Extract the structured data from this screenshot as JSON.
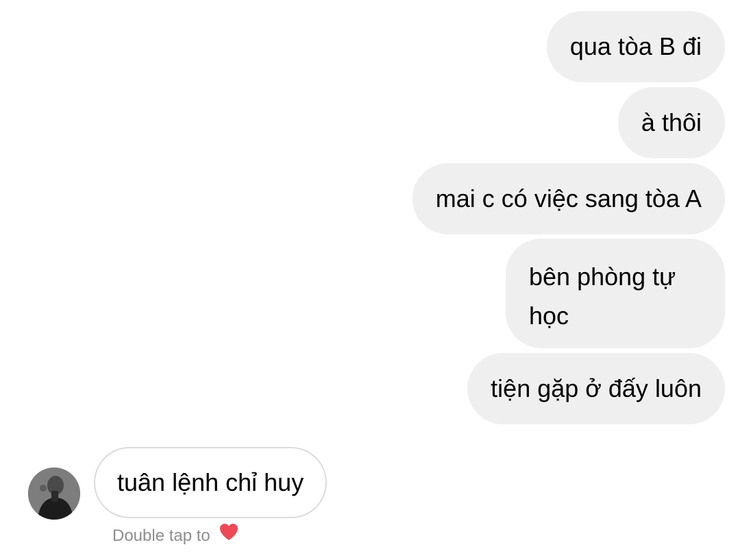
{
  "outgoing_messages": [
    {
      "text": "qua tòa B đi"
    },
    {
      "text": "à thôi"
    },
    {
      "text": "mai c có việc sang tòa A"
    },
    {
      "text": "bên phòng tự học"
    },
    {
      "text": "tiện gặp ở đấy luôn"
    }
  ],
  "incoming_message": {
    "text": "tuân lệnh chỉ huy",
    "hint": "Double tap to"
  },
  "colors": {
    "outgoing_bubble": "#efefef",
    "incoming_border": "#dbdbdb",
    "hint_text": "#8e8e8e",
    "heart": "#ed4956"
  },
  "icons": {
    "avatar": "user-avatar",
    "heart": "heart-icon"
  }
}
